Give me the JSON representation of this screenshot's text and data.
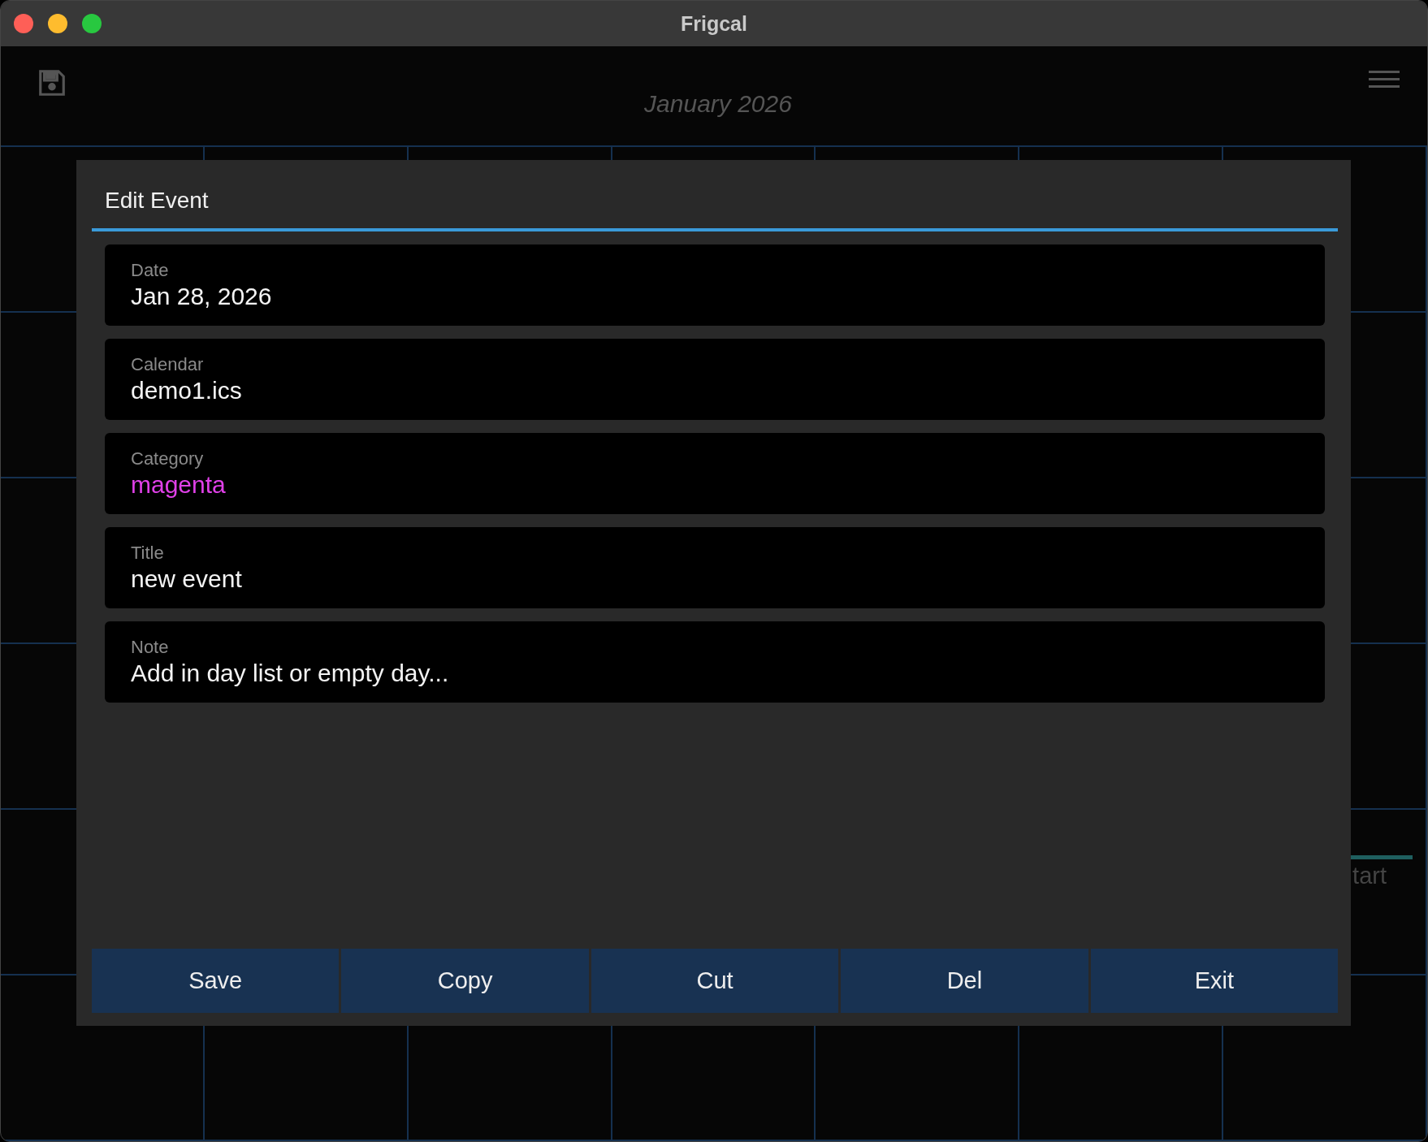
{
  "window": {
    "title": "Frigcal"
  },
  "header": {
    "month": "January 2026"
  },
  "calendar_grid": {
    "events": [
      {
        "text": "tart",
        "color": "#1f5f5f"
      }
    ]
  },
  "dialog": {
    "title": "Edit Event",
    "fields": [
      {
        "label": "Date",
        "value": "Jan 28, 2026"
      },
      {
        "label": "Calendar",
        "value": "demo1.ics"
      },
      {
        "label": "Category",
        "value": "magenta",
        "color": "#e040e8"
      },
      {
        "label": "Title",
        "value": "new event"
      },
      {
        "label": "Note",
        "value": "Add in day list or empty day..."
      }
    ],
    "buttons": [
      "Save",
      "Copy",
      "Cut",
      "Del",
      "Exit"
    ]
  }
}
